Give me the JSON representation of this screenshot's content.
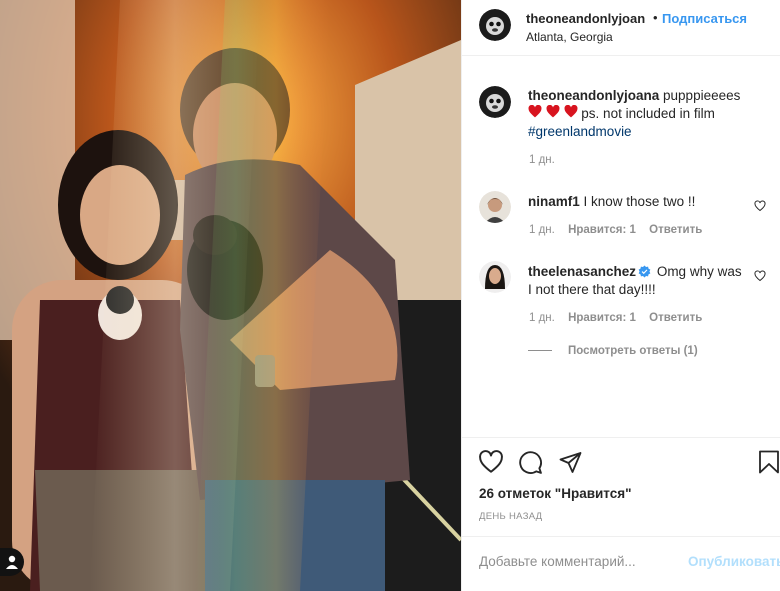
{
  "post": {
    "author": "theoneandonlyjoan",
    "follow_label": "Подписаться",
    "separator": "•",
    "location": "Atlanta, Georgia"
  },
  "caption": {
    "username": "theoneandonlyjoana",
    "text_line1": "pupppieeees",
    "text_line2": "ps. not included in film",
    "hashtag": "#greenlandmovie",
    "time": "1 дн."
  },
  "comments": [
    {
      "username": "ninamf1",
      "text": "I know those two !!",
      "time": "1 дн.",
      "likes_label": "Нравится: 1",
      "reply_label": "Ответить"
    },
    {
      "username": "theelenasanchez",
      "text": "Omg why was I not there that day!!!!",
      "time": "1 дн.",
      "likes_label": "Нравится: 1",
      "reply_label": "Ответить",
      "view_replies": "Посмотреть ответы (1)"
    }
  ],
  "stats": {
    "likes": "26 отметок \"Нравится\"",
    "date": "ДЕНЬ НАЗАД"
  },
  "composer": {
    "placeholder": "Добавьте комментарий...",
    "publish_label": "Опубликовать"
  },
  "colors": {
    "link_blue": "#3897f0",
    "hashtag": "#00376b",
    "heart_red": "#ed4956",
    "verified": "#3897f0",
    "muted": "#8e8e8e"
  },
  "icons": [
    "heart-icon",
    "comment-icon",
    "share-icon",
    "bookmark-icon",
    "verified-icon",
    "user-tag-icon"
  ]
}
